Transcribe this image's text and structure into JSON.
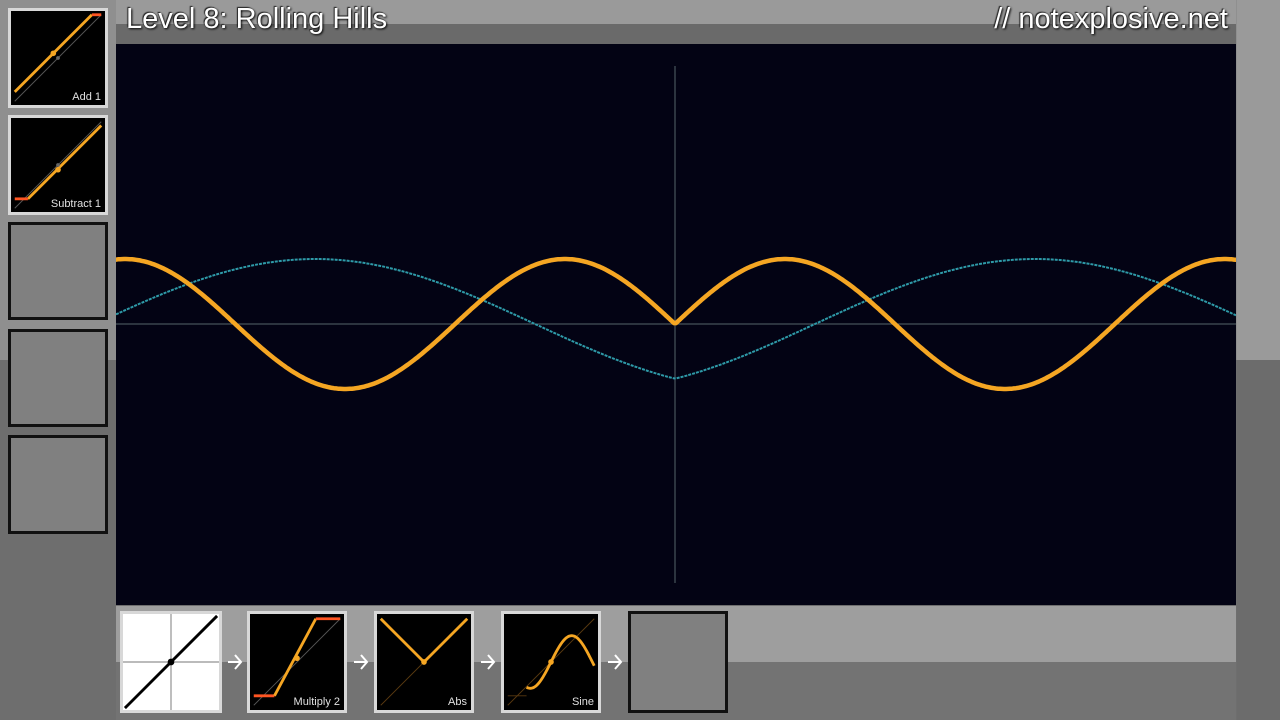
{
  "header": {
    "level_title": "Level 8: Rolling Hills",
    "site_credit": "// notexplosive.net"
  },
  "inventory": [
    {
      "label": "Add 1",
      "filled": true
    },
    {
      "label": "Subtract 1",
      "filled": true
    },
    {
      "label": "",
      "filled": false
    },
    {
      "label": "",
      "filled": false
    },
    {
      "label": "",
      "filled": false
    }
  ],
  "pipeline": [
    {
      "label": "",
      "kind": "identity"
    },
    {
      "label": "Multiply 2",
      "kind": "function"
    },
    {
      "label": "Abs",
      "kind": "function"
    },
    {
      "label": "Sine",
      "kind": "function"
    },
    {
      "label": "",
      "kind": "empty-slot"
    }
  ],
  "colors": {
    "graph_bg": "#030314",
    "player_curve": "#f5a623",
    "target_curve": "#2e9aa8",
    "axis": "#5a6a70",
    "clamp": "#ff5522"
  }
}
